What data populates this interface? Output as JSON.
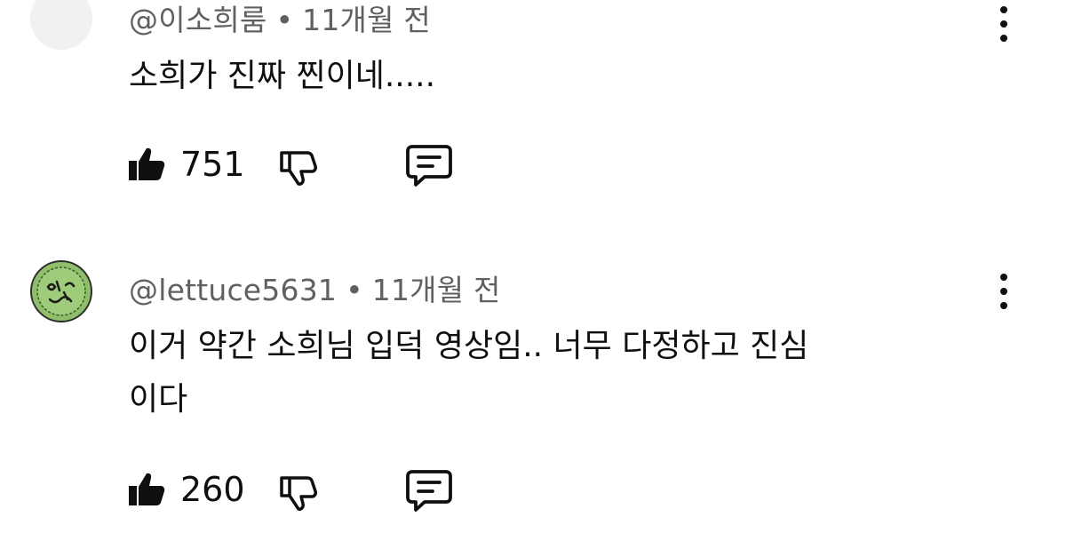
{
  "comments": [
    {
      "author": "@이소희룸",
      "separator": "•",
      "time": "11개월 전",
      "text_lines": [
        "소희가 진짜 찐이네....."
      ],
      "likes": "751"
    },
    {
      "author": "@lettuce5631",
      "separator": "•",
      "time": "11개월 전",
      "text_lines": [
        "이거 약간 소희님 입덕 영상임.. 너무 다정하고 진심",
        "이다"
      ],
      "likes": "260"
    }
  ],
  "icons": {
    "like": "thumbs-up-icon",
    "dislike": "thumbs-down-icon",
    "reply": "reply-comment-icon",
    "more": "more-vert-icon"
  },
  "colors": {
    "text": "#0f0f0f",
    "meta": "#606060",
    "avatar_green": "#8fbf6a"
  }
}
